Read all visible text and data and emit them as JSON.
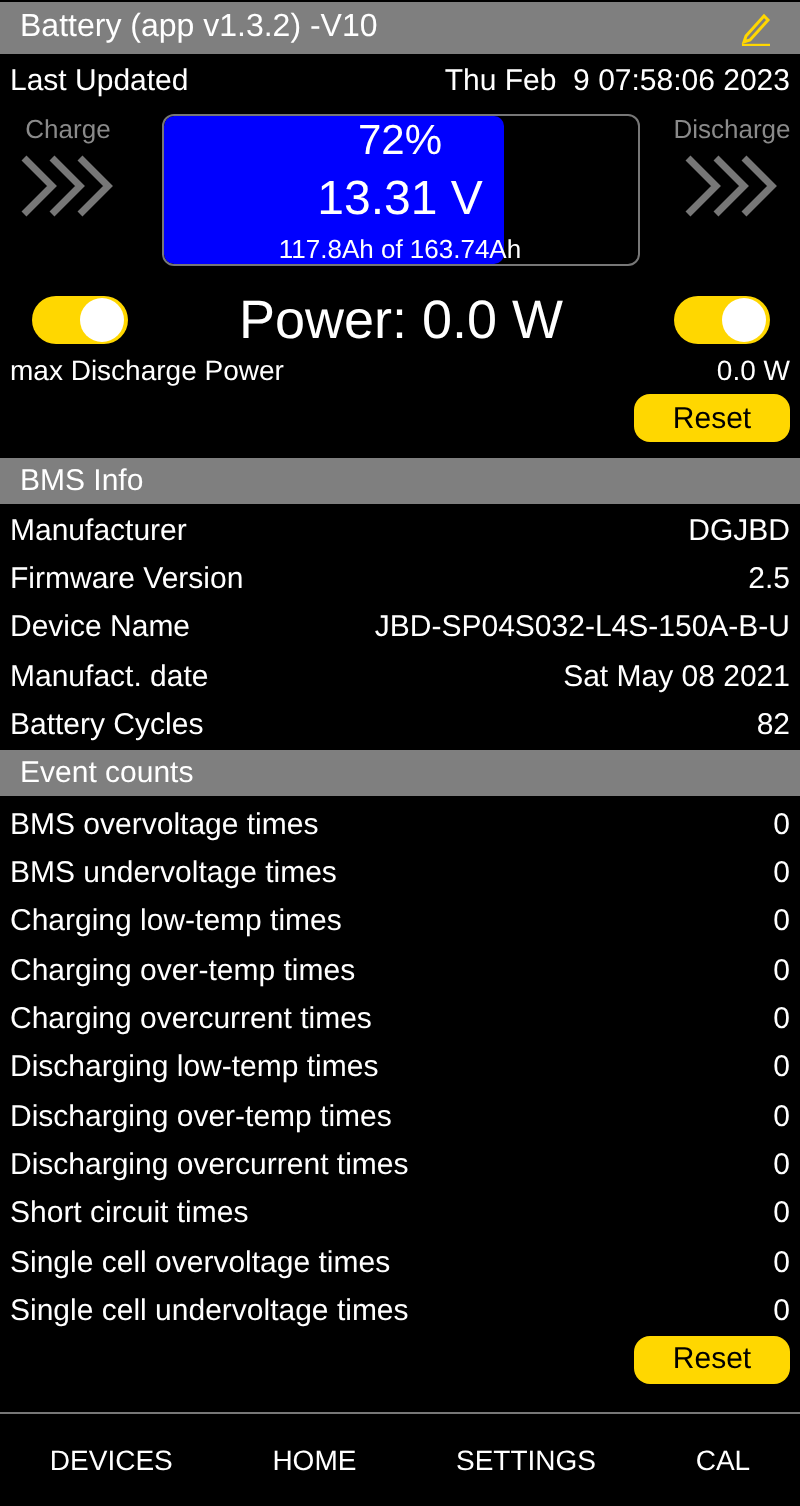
{
  "title_bar": {
    "title": "Battery (app v1.3.2) -V10"
  },
  "last_updated": {
    "label": "Last Updated",
    "value": "Thu Feb  9 07:58:06 2023"
  },
  "battery": {
    "charge_label": "Charge",
    "discharge_label": "Discharge",
    "percent": "72%",
    "voltage": "13.31 V",
    "capacity": "117.8Ah of 163.74Ah",
    "level": 0.72
  },
  "power": {
    "charge_switch_on": true,
    "text": "Power: 0.0 W",
    "discharge_switch_on": true,
    "max_label": "max Discharge Power",
    "max_value": "0.0 W",
    "reset": "Reset"
  },
  "bms_info": {
    "title": "BMS Info",
    "rows": [
      {
        "label": "Manufacturer",
        "value": "DGJBD"
      },
      {
        "label": "Firmware Version",
        "value": "2.5"
      },
      {
        "label": "Device Name",
        "value": "JBD-SP04S032-L4S-150A-B-U"
      },
      {
        "label": "Manufact. date",
        "value": "Sat May 08 2021"
      },
      {
        "label": "Battery Cycles",
        "value": "82"
      }
    ]
  },
  "event_counts": {
    "title": "Event counts",
    "rows": [
      {
        "label": "BMS overvoltage times",
        "value": "0"
      },
      {
        "label": "BMS undervoltage times",
        "value": "0"
      },
      {
        "label": "Charging low-temp times",
        "value": "0"
      },
      {
        "label": "Charging over-temp times",
        "value": "0"
      },
      {
        "label": "Charging overcurrent times",
        "value": "0"
      },
      {
        "label": "Discharging low-temp times",
        "value": "0"
      },
      {
        "label": "Discharging over-temp times",
        "value": "0"
      },
      {
        "label": "Discharging overcurrent times",
        "value": "0"
      },
      {
        "label": "Short circuit times",
        "value": "0"
      },
      {
        "label": "Single cell overvoltage times",
        "value": "0"
      },
      {
        "label": "Single cell undervoltage times",
        "value": "0"
      }
    ],
    "reset": "Reset"
  },
  "nav": [
    {
      "label": "DEVICES"
    },
    {
      "label": "HOME"
    },
    {
      "label": "SETTINGS"
    },
    {
      "label": "CAL"
    }
  ]
}
